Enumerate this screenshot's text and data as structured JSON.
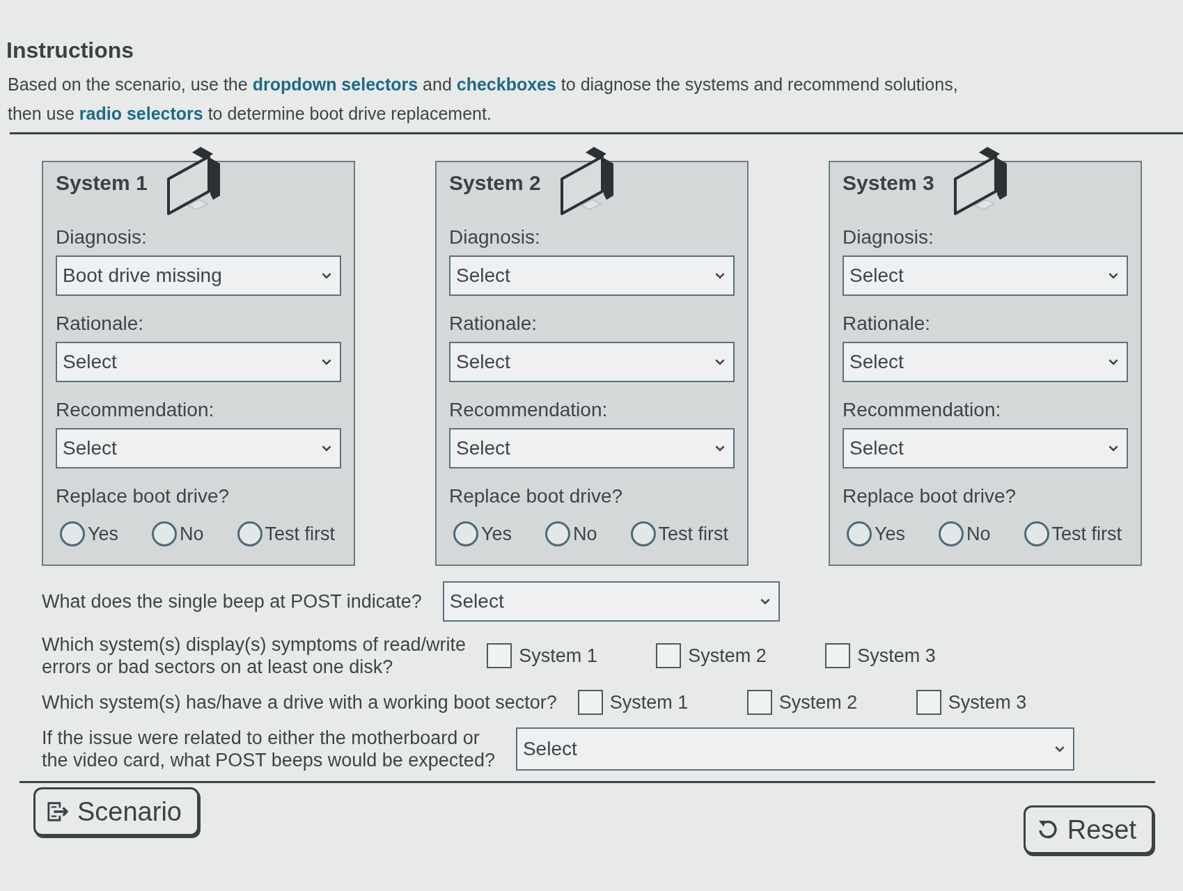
{
  "instructions": {
    "title": "Instructions",
    "lines": [
      "Based on the scenario, use the **dropdown selectors** and **checkboxes** to diagnose the systems and recommend solutions,",
      "then use **radio selectors** to determine boot drive replacement."
    ]
  },
  "systems": [
    {
      "title": "System 1",
      "fields": [
        {
          "label": "Diagnosis:",
          "value": "Boot drive missing"
        },
        {
          "label": "Rationale:",
          "value": "Select"
        },
        {
          "label": "Recommendation:",
          "value": "Select"
        }
      ],
      "question": "Replace boot drive?",
      "options": [
        {
          "label": "Yes",
          "selected": false
        },
        {
          "label": "No",
          "selected": false
        },
        {
          "label": "Test first",
          "selected": false
        }
      ]
    },
    {
      "title": "System 2",
      "fields": [
        {
          "label": "Diagnosis:",
          "value": "Select"
        },
        {
          "label": "Rationale:",
          "value": "Select"
        },
        {
          "label": "Recommendation:",
          "value": "Select"
        }
      ],
      "question": "Replace boot drive?",
      "options": [
        {
          "label": "Yes",
          "selected": false
        },
        {
          "label": "No",
          "selected": false
        },
        {
          "label": "Test first",
          "selected": false
        }
      ]
    },
    {
      "title": "System 3",
      "fields": [
        {
          "label": "Diagnosis:",
          "value": "Select"
        },
        {
          "label": "Rationale:",
          "value": "Select"
        },
        {
          "label": "Recommendation:",
          "value": "Select"
        }
      ],
      "question": "Replace boot drive?",
      "options": [
        {
          "label": "Yes",
          "selected": false
        },
        {
          "label": "No",
          "selected": false
        },
        {
          "label": "Test first",
          "selected": false
        }
      ]
    }
  ],
  "questions": [
    {
      "kind": "select",
      "lines": [
        "What does the single beep at POST indicate?"
      ],
      "value": "Select"
    },
    {
      "kind": "checkboxes",
      "lines": [
        "Which system(s) display(s) symptoms of read/write",
        "errors or bad sectors on at least one disk?"
      ],
      "options": [
        {
          "label": "System 1",
          "checked": false
        },
        {
          "label": "System 2",
          "checked": false
        },
        {
          "label": "System 3",
          "checked": false
        }
      ]
    },
    {
      "kind": "checkboxes",
      "lines": [
        "Which system(s) has/have a drive with a working boot sector?"
      ],
      "options": [
        {
          "label": "System 1",
          "checked": false
        },
        {
          "label": "System 2",
          "checked": false
        },
        {
          "label": "System 3",
          "checked": false
        }
      ]
    },
    {
      "kind": "select",
      "lines": [
        "If the issue were related to either the motherboard or",
        "the video card, what POST beeps would be expected?"
      ],
      "value": "Select"
    }
  ],
  "buttons": [
    {
      "kind": "scenario",
      "label": "Scenario"
    },
    {
      "kind": "reset",
      "label": "Reset"
    }
  ]
}
